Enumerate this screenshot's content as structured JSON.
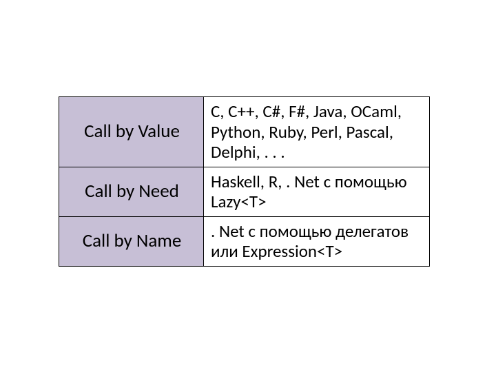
{
  "table": {
    "rows": [
      {
        "label": "Call by Value",
        "desc": "C, C++, C#, F#, Java, OCaml, Python, Ruby, Perl, Pascal, Delphi, . . ."
      },
      {
        "label": "Call by Need",
        "desc": "Haskell, R, . Net с помощью Lazy<T>"
      },
      {
        "label": "Call by Name",
        "desc": ". Net с помощью делегатов или Expression<T>"
      }
    ]
  }
}
